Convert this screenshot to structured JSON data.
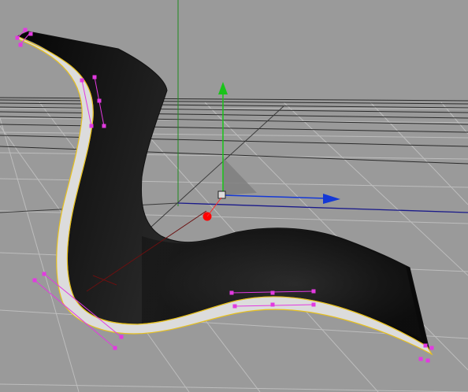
{
  "viewport": {
    "view": "perspective",
    "colors": {
      "background": "#9a9a9a",
      "grid_line": "#bdbdbd",
      "grid_dark": "#3a3a3a",
      "horizon_dark": "#222222",
      "surface_dark": "#111111",
      "surface_mid": "#2b2b2b",
      "surface_edge": "#dcdcdc",
      "edge_outline": "#e6c020",
      "spline_handle": "#e23ae0",
      "axis_y": "#19c419",
      "axis_x": "#1438d6",
      "world_y": "#1d8a1d",
      "world_x_dark": "#1a1a8a",
      "origin_point": "#ff0000",
      "shadow": "#7f7f7f"
    },
    "objects": {
      "mesh": "chair-shell",
      "spline_point_icon": "square-handle",
      "gizmo": "move-axis-gizmo",
      "origin": "red-sphere-origin"
    }
  }
}
